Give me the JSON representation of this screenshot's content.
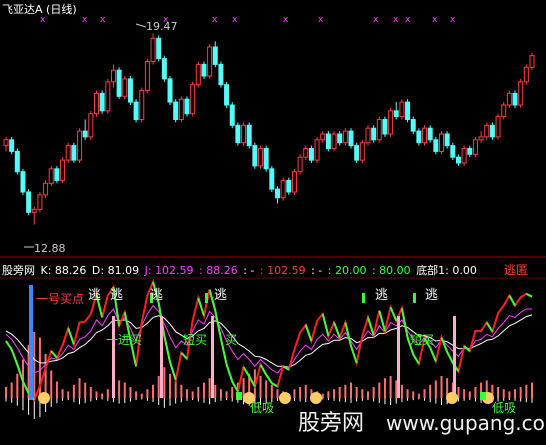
{
  "upper_panel": {
    "title": "飞亚达A",
    "period": "(日线)",
    "high_label": "19.47",
    "low_label": "12.88",
    "x_markers": [
      "x",
      "x",
      "x",
      "x",
      "x",
      "x",
      "x",
      "x",
      "x",
      "x",
      "x",
      "x"
    ]
  },
  "lower_panel": {
    "indicator_name": "股旁网",
    "k_label": "K: 88.26",
    "d_label": "D: 81.09",
    "j_label": "J: 102.59",
    "v1_label": ": 88.26",
    "v2_label": ": -",
    "v3_label": ": 102.59",
    "v4_label": ": -",
    "v5_label": ": 20.00",
    "v6_label": ": 80.00",
    "bottom_label": "底部1: 0.00",
    "status_label": "逃匿",
    "texts": {
      "first_buy": "一号买点",
      "escape": "逃",
      "double_buy": "一进买",
      "short_buy": "短买",
      "buy": "买",
      "low_buy": "低吸"
    }
  },
  "watermark": {
    "cn": "股旁网",
    "url": "www.gupang.com"
  },
  "colors": {
    "up": "#ff3c3c",
    "down": "#54fcfc",
    "green": "#3cff3c",
    "magenta": "#ff40ff",
    "white": "#ffffff",
    "red_grid": "#a00000",
    "yellow": "#ffff54"
  },
  "chart_data": {
    "type": "candlestick",
    "price_range": [
      12.0,
      20.0
    ],
    "candles": [
      [
        15.6,
        15.9,
        15.4,
        15.8
      ],
      [
        15.8,
        15.9,
        15.3,
        15.4
      ],
      [
        15.4,
        15.5,
        14.6,
        14.7
      ],
      [
        14.7,
        14.8,
        13.9,
        14.0
      ],
      [
        14.0,
        14.1,
        13.2,
        13.3
      ],
      [
        13.3,
        13.5,
        12.88,
        13.4
      ],
      [
        13.4,
        14.0,
        13.3,
        13.9
      ],
      [
        13.9,
        14.4,
        13.8,
        14.3
      ],
      [
        14.3,
        14.9,
        14.2,
        14.8
      ],
      [
        14.8,
        14.9,
        14.3,
        14.4
      ],
      [
        14.4,
        15.2,
        14.3,
        15.1
      ],
      [
        15.1,
        15.7,
        15.0,
        15.6
      ],
      [
        15.6,
        15.7,
        15.0,
        15.1
      ],
      [
        15.1,
        16.2,
        15.0,
        16.1
      ],
      [
        16.1,
        16.5,
        15.8,
        15.9
      ],
      [
        15.9,
        16.8,
        15.8,
        16.7
      ],
      [
        16.7,
        17.5,
        16.6,
        17.4
      ],
      [
        17.4,
        17.5,
        16.7,
        16.8
      ],
      [
        16.8,
        17.9,
        16.7,
        17.8
      ],
      [
        17.8,
        18.4,
        17.6,
        18.2
      ],
      [
        18.2,
        18.3,
        17.2,
        17.3
      ],
      [
        17.3,
        18.0,
        17.2,
        17.9
      ],
      [
        17.9,
        18.0,
        17.0,
        17.1
      ],
      [
        17.1,
        17.2,
        16.4,
        16.5
      ],
      [
        16.5,
        17.6,
        16.4,
        17.5
      ],
      [
        17.5,
        18.6,
        17.4,
        18.5
      ],
      [
        18.5,
        19.47,
        18.4,
        19.3
      ],
      [
        19.3,
        19.4,
        18.5,
        18.6
      ],
      [
        18.6,
        18.7,
        17.8,
        17.9
      ],
      [
        17.9,
        18.0,
        17.0,
        17.1
      ],
      [
        17.1,
        17.2,
        16.4,
        16.5
      ],
      [
        16.5,
        17.3,
        16.4,
        17.2
      ],
      [
        17.2,
        17.3,
        16.6,
        16.7
      ],
      [
        16.7,
        17.8,
        16.6,
        17.7
      ],
      [
        17.7,
        18.5,
        17.6,
        18.4
      ],
      [
        18.4,
        18.5,
        17.9,
        18.0
      ],
      [
        18.0,
        19.1,
        17.9,
        19.0
      ],
      [
        19.0,
        19.2,
        18.3,
        18.4
      ],
      [
        18.4,
        18.5,
        17.6,
        17.7
      ],
      [
        17.7,
        17.8,
        16.9,
        17.0
      ],
      [
        17.0,
        17.1,
        16.2,
        16.3
      ],
      [
        16.3,
        16.4,
        15.6,
        15.7
      ],
      [
        15.7,
        16.4,
        15.6,
        16.3
      ],
      [
        16.3,
        16.4,
        15.5,
        15.6
      ],
      [
        15.6,
        15.7,
        14.8,
        14.9
      ],
      [
        14.9,
        15.6,
        14.8,
        15.5
      ],
      [
        15.5,
        15.6,
        14.7,
        14.8
      ],
      [
        14.8,
        14.9,
        14.0,
        14.1
      ],
      [
        14.1,
        14.2,
        13.6,
        13.8
      ],
      [
        13.8,
        14.5,
        13.7,
        14.4
      ],
      [
        14.4,
        14.5,
        13.9,
        14.0
      ],
      [
        14.0,
        14.8,
        13.9,
        14.7
      ],
      [
        14.7,
        15.3,
        14.6,
        15.2
      ],
      [
        15.2,
        15.6,
        15.1,
        15.5
      ],
      [
        15.5,
        15.6,
        15.0,
        15.1
      ],
      [
        15.1,
        15.9,
        15.0,
        15.8
      ],
      [
        15.8,
        16.1,
        15.7,
        16.0
      ],
      [
        16.0,
        16.1,
        15.4,
        15.5
      ],
      [
        15.5,
        16.1,
        15.4,
        16.0
      ],
      [
        16.0,
        16.1,
        15.6,
        15.7
      ],
      [
        15.7,
        16.2,
        15.6,
        16.1
      ],
      [
        16.1,
        16.2,
        15.5,
        15.6
      ],
      [
        15.6,
        15.7,
        15.0,
        15.1
      ],
      [
        15.1,
        15.8,
        15.0,
        15.7
      ],
      [
        15.7,
        16.3,
        15.6,
        16.2
      ],
      [
        16.2,
        16.3,
        15.7,
        15.8
      ],
      [
        15.8,
        16.6,
        15.7,
        16.5
      ],
      [
        16.5,
        16.6,
        15.9,
        16.0
      ],
      [
        16.0,
        16.9,
        15.9,
        16.8
      ],
      [
        16.8,
        17.1,
        16.5,
        16.6
      ],
      [
        16.6,
        17.2,
        16.5,
        17.1
      ],
      [
        17.1,
        17.2,
        16.4,
        16.5
      ],
      [
        16.5,
        16.6,
        16.0,
        16.1
      ],
      [
        16.1,
        16.2,
        15.6,
        15.7
      ],
      [
        15.7,
        16.3,
        15.6,
        16.2
      ],
      [
        16.2,
        16.3,
        15.7,
        15.8
      ],
      [
        15.8,
        15.9,
        15.3,
        15.4
      ],
      [
        15.4,
        16.1,
        15.3,
        16.0
      ],
      [
        16.0,
        16.1,
        15.5,
        15.6
      ],
      [
        15.6,
        15.7,
        15.1,
        15.2
      ],
      [
        15.2,
        15.3,
        14.9,
        15.0
      ],
      [
        15.0,
        15.6,
        14.9,
        15.5
      ],
      [
        15.5,
        15.6,
        15.2,
        15.3
      ],
      [
        15.3,
        15.9,
        15.2,
        15.8
      ],
      [
        15.8,
        16.1,
        15.7,
        15.9
      ],
      [
        15.9,
        16.4,
        15.8,
        16.3
      ],
      [
        16.3,
        16.4,
        15.8,
        15.9
      ],
      [
        15.9,
        16.7,
        15.8,
        16.6
      ],
      [
        16.6,
        17.1,
        16.5,
        17.0
      ],
      [
        17.0,
        17.5,
        16.9,
        17.4
      ],
      [
        17.4,
        17.5,
        16.9,
        17.0
      ],
      [
        17.0,
        17.9,
        16.9,
        17.8
      ],
      [
        17.8,
        18.4,
        17.7,
        18.3
      ],
      [
        18.3,
        18.8,
        18.2,
        18.7
      ]
    ],
    "k": [
      58,
      52,
      42,
      30,
      20,
      12,
      15,
      22,
      30,
      28,
      35,
      45,
      40,
      52,
      55,
      62,
      75,
      68,
      80,
      88,
      72,
      78,
      65,
      50,
      68,
      82,
      92,
      85,
      70,
      55,
      42,
      50,
      45,
      62,
      75,
      70,
      85,
      78,
      65,
      50,
      38,
      28,
      35,
      28,
      20,
      28,
      22,
      16,
      12,
      20,
      18,
      28,
      38,
      45,
      40,
      52,
      58,
      50,
      58,
      52,
      60,
      50,
      40,
      52,
      62,
      55,
      68,
      60,
      72,
      68,
      75,
      62,
      52,
      45,
      55,
      50,
      42,
      52,
      45,
      38,
      32,
      42,
      40,
      50,
      52,
      58,
      55,
      65,
      72,
      80,
      78,
      84,
      88,
      88
    ],
    "d": [
      62,
      58,
      52,
      44,
      36,
      28,
      24,
      24,
      26,
      27,
      30,
      35,
      37,
      42,
      46,
      52,
      60,
      63,
      68,
      75,
      74,
      75,
      72,
      65,
      66,
      71,
      78,
      80,
      77,
      70,
      61,
      57,
      53,
      56,
      62,
      65,
      72,
      74,
      71,
      64,
      56,
      47,
      43,
      38,
      32,
      31,
      28,
      24,
      20,
      20,
      19,
      22,
      27,
      33,
      35,
      41,
      46,
      47,
      51,
      51,
      54,
      53,
      48,
      50,
      54,
      54,
      59,
      59,
      63,
      65,
      68,
      66,
      61,
      56,
      56,
      54,
      50,
      51,
      49,
      45,
      41,
      41,
      41,
      44,
      47,
      51,
      52,
      56,
      62,
      68,
      71,
      75,
      79,
      81
    ],
    "j": [
      50,
      40,
      22,
      2,
      -12,
      -20,
      -3,
      18,
      38,
      30,
      45,
      65,
      46,
      72,
      73,
      82,
      105,
      78,
      104,
      114,
      68,
      84,
      51,
      20,
      72,
      104,
      120,
      95,
      56,
      25,
      4,
      36,
      29,
      74,
      101,
      80,
      111,
      86,
      53,
      22,
      2,
      -10,
      19,
      8,
      -4,
      22,
      10,
      0,
      -4,
      20,
      16,
      40,
      60,
      69,
      50,
      74,
      82,
      56,
      72,
      54,
      72,
      44,
      24,
      56,
      78,
      57,
      86,
      62,
      90,
      74,
      89,
      54,
      34,
      23,
      53,
      42,
      26,
      54,
      37,
      24,
      14,
      44,
      38,
      62,
      62,
      72,
      61,
      83,
      92,
      104,
      92,
      102,
      106,
      102.59
    ],
    "osc_bars": [
      10,
      14,
      22,
      35,
      48,
      60,
      55,
      40,
      25,
      15,
      8,
      6,
      12,
      18,
      14,
      10,
      6,
      4,
      8,
      12,
      16,
      14,
      10,
      6,
      4,
      8,
      12,
      20,
      28,
      22,
      16,
      12,
      8,
      6,
      10,
      14,
      18,
      12,
      8,
      6,
      10,
      14,
      18,
      22,
      26,
      20,
      16,
      12,
      8,
      6,
      4,
      8,
      10,
      12,
      8,
      6,
      4,
      6,
      8,
      10,
      12,
      14,
      10,
      8,
      6,
      10,
      14,
      18,
      20,
      16,
      12,
      8,
      6,
      4,
      8,
      12,
      16,
      20,
      18,
      14,
      10,
      8,
      6,
      10,
      14,
      16,
      12,
      10,
      8,
      6,
      8,
      10,
      12,
      14
    ]
  }
}
